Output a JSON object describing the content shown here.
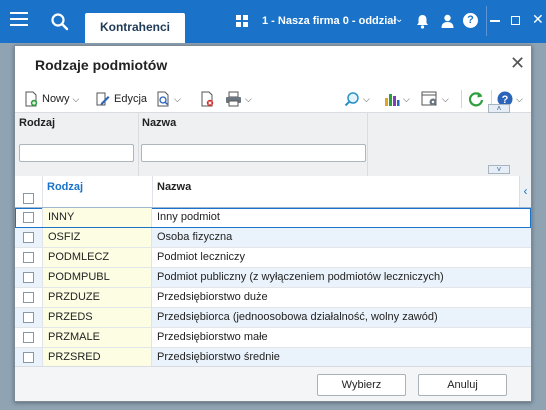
{
  "appbar": {
    "tab_label": "Kontrahenci",
    "company": "1 - Nasza firma 0 - oddział",
    "icons": [
      "menu-icon",
      "search-icon",
      "grid-icon",
      "bell-icon",
      "user-icon",
      "help-icon"
    ]
  },
  "dialog": {
    "title": "Rodzaje podmiotów",
    "toolbar": {
      "new_label": "Nowy",
      "edit_label": "Edycja"
    },
    "filter": {
      "col1_label": "Rodzaj",
      "col2_label": "Nazwa",
      "col1_value": "",
      "col2_value": ""
    },
    "grid": {
      "headers": [
        "Rodzaj",
        "Nazwa"
      ],
      "rows": [
        {
          "code": "INNY",
          "name": "Inny podmiot"
        },
        {
          "code": "OSFIZ",
          "name": "Osoba fizyczna"
        },
        {
          "code": "PODMLECZ",
          "name": "Podmiot leczniczy"
        },
        {
          "code": "PODMPUBL",
          "name": "Podmiot publiczny (z wyłączeniem podmiotów leczniczych)"
        },
        {
          "code": "PRZDUZE",
          "name": "Przedsiębiorstwo duże"
        },
        {
          "code": "PRZEDS",
          "name": "Przedsiębiorca (jednoosobowa działalność, wolny zawód)"
        },
        {
          "code": "PRZMALE",
          "name": "Przedsiębiorstwo małe"
        },
        {
          "code": "PRZSRED",
          "name": "Przedsiębiorstwo średnie"
        }
      ]
    },
    "buttons": {
      "select_label": "Wybierz",
      "cancel_label": "Anuluj"
    }
  },
  "colors": {
    "accent": "#1a73c9",
    "code_cell": "#fdfde3",
    "alt_row": "#eaf3fb"
  }
}
